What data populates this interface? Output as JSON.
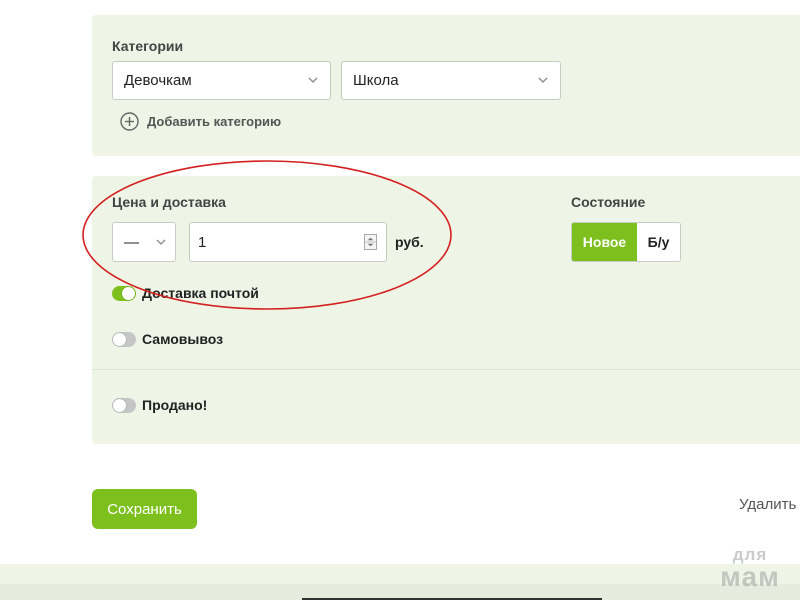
{
  "categories": {
    "label": "Категории",
    "primary_value": "Девочкам",
    "secondary_value": "Школа",
    "add_label": "Добавить категорию"
  },
  "price": {
    "label": "Цена и доставка",
    "type_value": "—",
    "amount_value": "1",
    "currency": "руб."
  },
  "condition": {
    "label": "Состояние",
    "new_label": "Новое",
    "used_label": "Б/у",
    "selected": "Новое"
  },
  "delivery": {
    "mail_label": "Доставка почтой",
    "mail_enabled": true,
    "pickup_label": "Самовывоз",
    "pickup_enabled": false
  },
  "sold": {
    "label": "Продано!",
    "enabled": false
  },
  "actions": {
    "save_label": "Сохранить",
    "delete_label": "Удалить"
  },
  "watermark": {
    "top": "для",
    "bottom": "мам"
  },
  "colors": {
    "accent": "#7dc01e",
    "panel_bg": "#eff5e6",
    "annotation": "#d42020"
  }
}
